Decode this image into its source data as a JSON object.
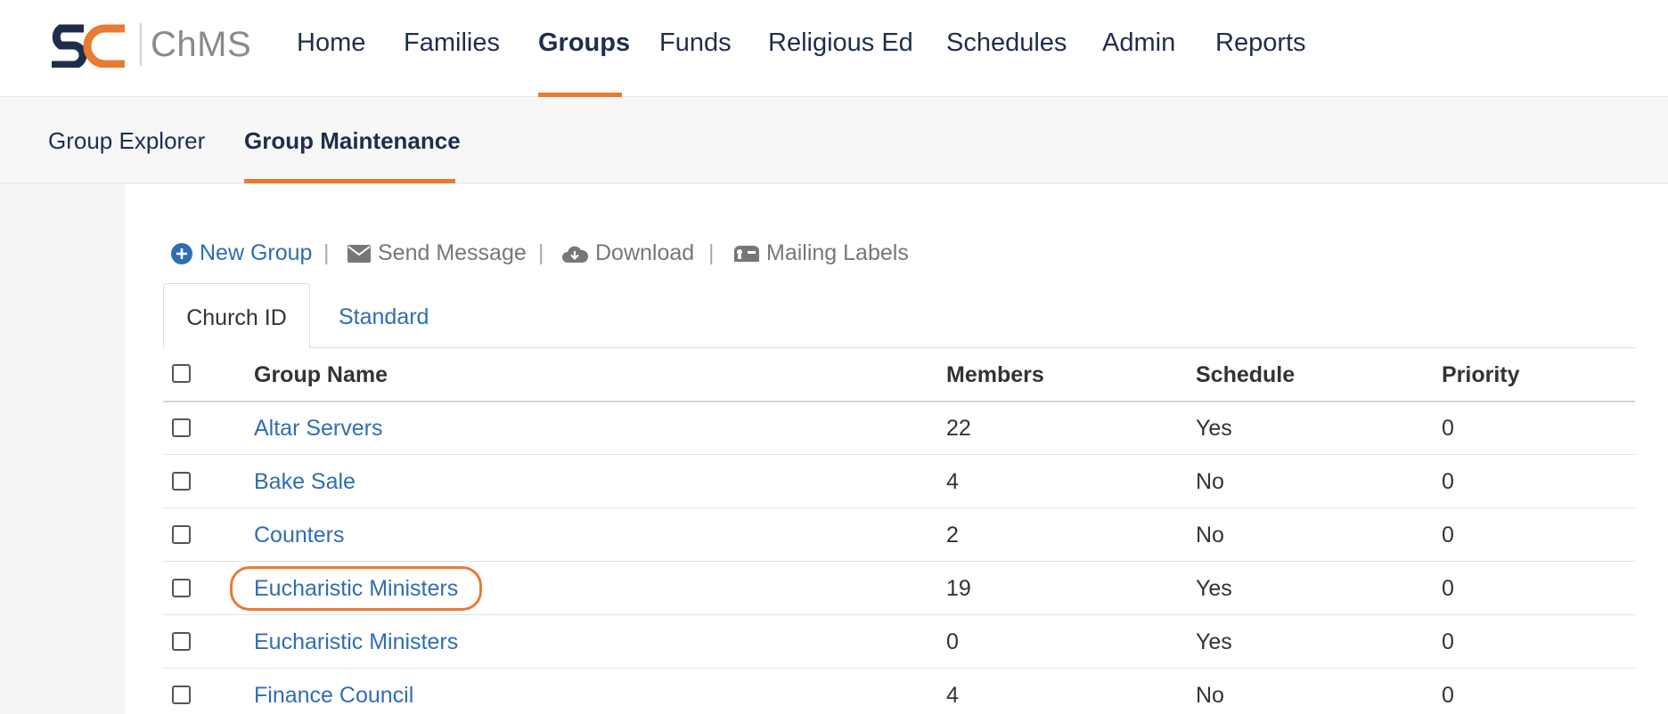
{
  "brand": {
    "logo_letters": "SC",
    "app_name": "ChMS",
    "accent": "#e87b31",
    "navy": "#1f2d4d"
  },
  "nav": {
    "items": [
      {
        "label": "Home"
      },
      {
        "label": "Families"
      },
      {
        "label": "Groups",
        "active": true
      },
      {
        "label": "Funds"
      },
      {
        "label": "Religious Ed"
      },
      {
        "label": "Schedules"
      },
      {
        "label": "Admin"
      },
      {
        "label": "Reports"
      }
    ]
  },
  "subnav": {
    "items": [
      {
        "label": "Group Explorer"
      },
      {
        "label": "Group Maintenance",
        "active": true
      }
    ]
  },
  "toolbar": {
    "new_group": "New Group",
    "send_message": "Send Message",
    "download": "Download",
    "mailing_labels": "Mailing Labels",
    "separator": "|",
    "icons": [
      "plus-circle-icon",
      "envelope-icon",
      "cloud-download-icon",
      "mailbox-icon"
    ]
  },
  "tabs": [
    {
      "label": "Church ID",
      "active": true
    },
    {
      "label": "Standard"
    }
  ],
  "table": {
    "columns": [
      "Group Name",
      "Members",
      "Schedule",
      "Priority"
    ],
    "rows": [
      {
        "name": "Altar Servers",
        "members": "22",
        "schedule": "Yes",
        "priority": "0"
      },
      {
        "name": "Bake Sale",
        "members": "4",
        "schedule": "No",
        "priority": "0"
      },
      {
        "name": "Counters",
        "members": "2",
        "schedule": "No",
        "priority": "0"
      },
      {
        "name": "Eucharistic Ministers",
        "members": "19",
        "schedule": "Yes",
        "priority": "0",
        "highlighted": true
      },
      {
        "name": "Eucharistic Ministers",
        "members": "0",
        "schedule": "Yes",
        "priority": "0"
      },
      {
        "name": "Finance Council",
        "members": "4",
        "schedule": "No",
        "priority": "0"
      }
    ]
  }
}
